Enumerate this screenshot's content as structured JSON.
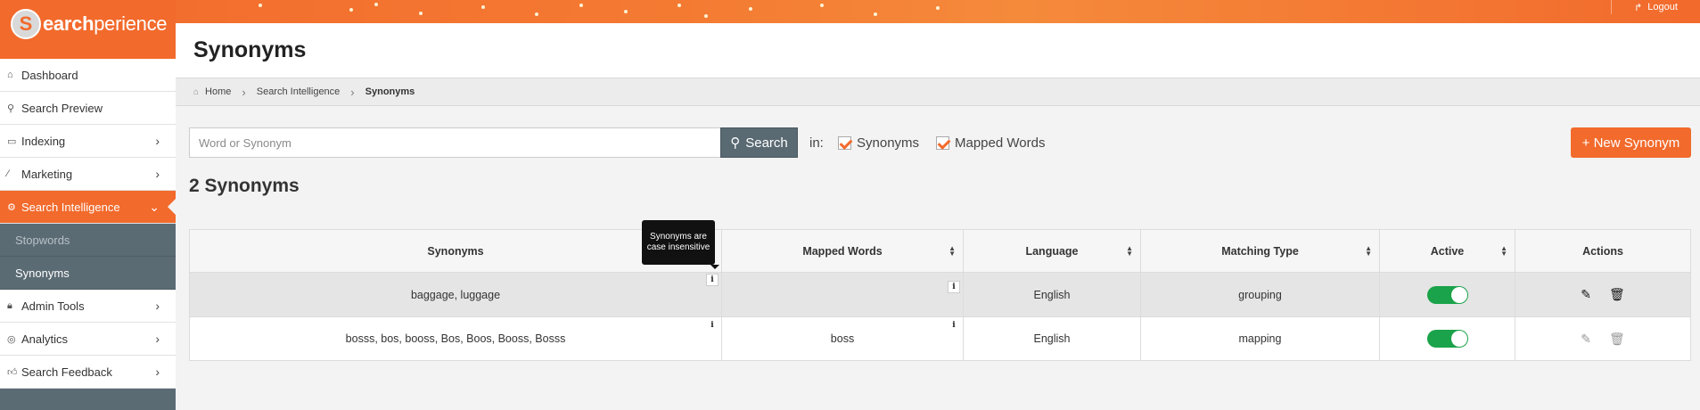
{
  "app": {
    "brand_prefix": "S",
    "brand_bold": "earch",
    "brand_rest": "perience",
    "logout_label": "Logout"
  },
  "sidebar": {
    "items": [
      {
        "label": "Dashboard",
        "icon": "home-icon"
      },
      {
        "label": "Search Preview",
        "icon": "search-icon"
      },
      {
        "label": "Indexing",
        "icon": "inbox-icon"
      },
      {
        "label": "Marketing",
        "icon": "wand-icon"
      },
      {
        "label": "Search Intelligence",
        "icon": "gear-icon"
      },
      {
        "label": "Admin Tools",
        "icon": "lock-icon"
      },
      {
        "label": "Analytics",
        "icon": "gauge-icon"
      },
      {
        "label": "Search Feedback",
        "icon": "thumbs-up-icon"
      }
    ],
    "subitems": [
      {
        "label": "Stopwords"
      },
      {
        "label": "Synonyms"
      }
    ]
  },
  "page": {
    "title": "Synonyms"
  },
  "breadcrumb": {
    "home": "Home",
    "section": "Search Intelligence",
    "current": "Synonyms"
  },
  "search": {
    "placeholder": "Word or Synonym",
    "value": "",
    "button": "Search",
    "in_label": "in:",
    "filter_synonyms": "Synonyms",
    "filter_mapped": "Mapped Words"
  },
  "new_button": "+ New Synonym",
  "count_title": "2 Synonyms",
  "table": {
    "columns": [
      "Synonyms",
      "Mapped Words",
      "Language",
      "Matching Type",
      "Active",
      "Actions"
    ],
    "tooltip": "Synonyms are case insensitive",
    "rows": [
      {
        "synonyms": "baggage, luggage",
        "mapped": "",
        "language": "English",
        "matching": "grouping",
        "active": true
      },
      {
        "synonyms": "bosss, bos, booss, Bos, Boos, Booss, Bosss",
        "mapped": "boss",
        "language": "English",
        "matching": "mapping",
        "active": true
      }
    ]
  },
  "colors": {
    "accent": "#f26a2c",
    "sidebar": "#5b6b74",
    "toggle_on": "#1aa34a"
  }
}
